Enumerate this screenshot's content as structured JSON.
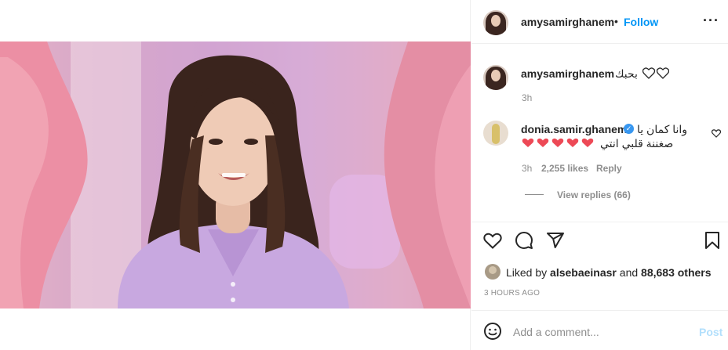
{
  "post": {
    "author": "amysamirghanem",
    "follow_label": "Follow",
    "more_icon": "more-icon",
    "separator": "•"
  },
  "caption": {
    "author": "amysamirghanem",
    "text": "بحبك",
    "time": "3h"
  },
  "comment": {
    "author": "donia.samir.ghanem",
    "line1": "وانا كمان يا",
    "line2": "صغننة قلبي انتي",
    "time": "3h",
    "likes": "2,255 likes",
    "reply_label": "Reply",
    "view_replies": "View replies (66)"
  },
  "likes": {
    "prefix": "Liked by",
    "user": "alsebaeinasr",
    "connector": "and",
    "others": "88,683 others"
  },
  "timestamp": "3 hours ago",
  "add_comment": {
    "placeholder": "Add a comment...",
    "post_label": "Post"
  },
  "colors": {
    "accent": "#0095f6",
    "heart_red": "#ed4956",
    "muted": "#8e8e8e",
    "post_disabled": "#b2dffc"
  }
}
